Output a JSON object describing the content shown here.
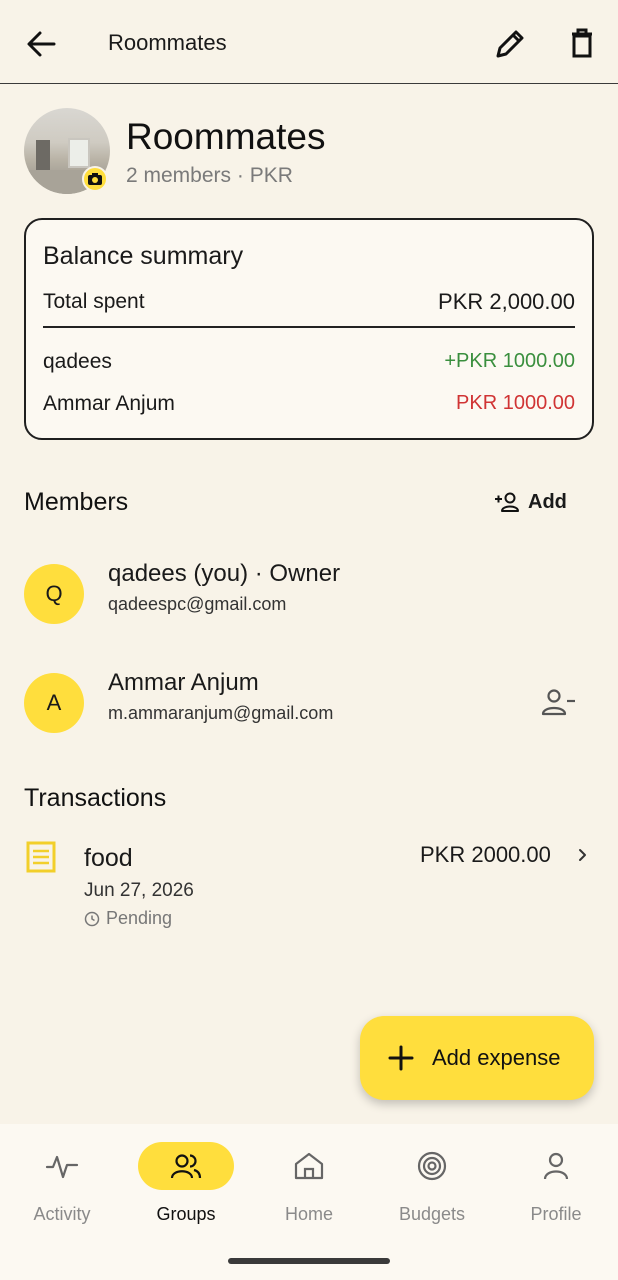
{
  "appbar": {
    "title": "Roommates"
  },
  "group": {
    "name": "Roommates",
    "meta": "2 members · PKR"
  },
  "balance": {
    "title": "Balance summary",
    "total_label": "Total spent",
    "total_value": "PKR 2,000.00",
    "rows": [
      {
        "name": "qadees",
        "amount": "+PKR 1000.00",
        "status_color": "#3a8f3e"
      },
      {
        "name": "Ammar Anjum",
        "amount": "PKR 1000.00",
        "status_color": "#d03434"
      }
    ]
  },
  "members": {
    "title": "Members",
    "add_label": "Add",
    "list": [
      {
        "initial": "Q",
        "name": "qadees (you) · Owner",
        "email": "qadeespc@gmail.com"
      },
      {
        "initial": "A",
        "name": "Ammar Anjum",
        "email": "m.ammaranjum@gmail.com"
      }
    ]
  },
  "transactions": {
    "title": "Transactions",
    "list": [
      {
        "name": "food",
        "date": "Jun 27, 2026",
        "status": "Pending",
        "amount": "PKR 2000.00"
      }
    ]
  },
  "fab": {
    "label": "Add expense"
  },
  "nav": {
    "items": [
      {
        "label": "Activity",
        "icon": "activity-icon"
      },
      {
        "label": "Groups",
        "icon": "groups-icon",
        "active": true
      },
      {
        "label": "Home",
        "icon": "home-icon"
      },
      {
        "label": "Budgets",
        "icon": "target-icon"
      },
      {
        "label": "Profile",
        "icon": "profile-icon"
      }
    ]
  },
  "colors": {
    "accent": "#ffde3d",
    "background": "#f8f3e8",
    "positive": "#3a8f3e",
    "negative": "#d03434"
  }
}
